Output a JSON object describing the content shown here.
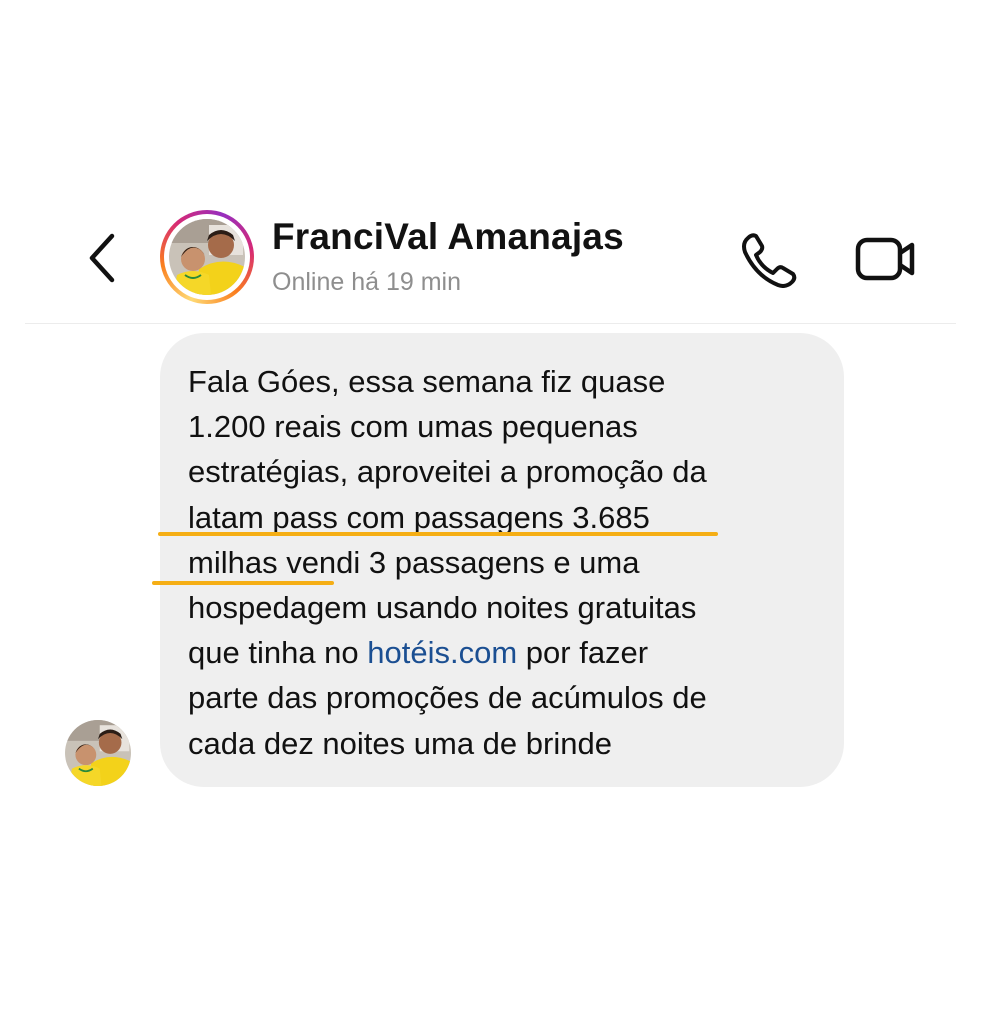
{
  "header": {
    "name": "FranciVal Amanajas",
    "status": "Online há 19 min"
  },
  "message": {
    "line1": "Fala Góes, essa semana fiz quase",
    "line2": "1.200 reais com umas pequenas",
    "line3": "estratégias, aproveitei a promoção da",
    "line4": "latam pass com passagens 3.685",
    "line5": "milhas vendi 3 passagens e uma",
    "line6": "hospedagem usando noites gratuitas",
    "line7_prefix": "que tinha no ",
    "line7_link": "hotéis.com",
    "line7_suffix": " por fazer",
    "line8": "parte das promoções de acúmulos de",
    "line9": "cada dez noites uma de brinde"
  },
  "colors": {
    "highlight_underline": "#f5ae15",
    "link": "#1b4f92",
    "bubble": "#efefef",
    "status_text": "#8e8e8e"
  },
  "icons": [
    "chevron-left-icon",
    "phone-icon",
    "video-camera-icon"
  ]
}
